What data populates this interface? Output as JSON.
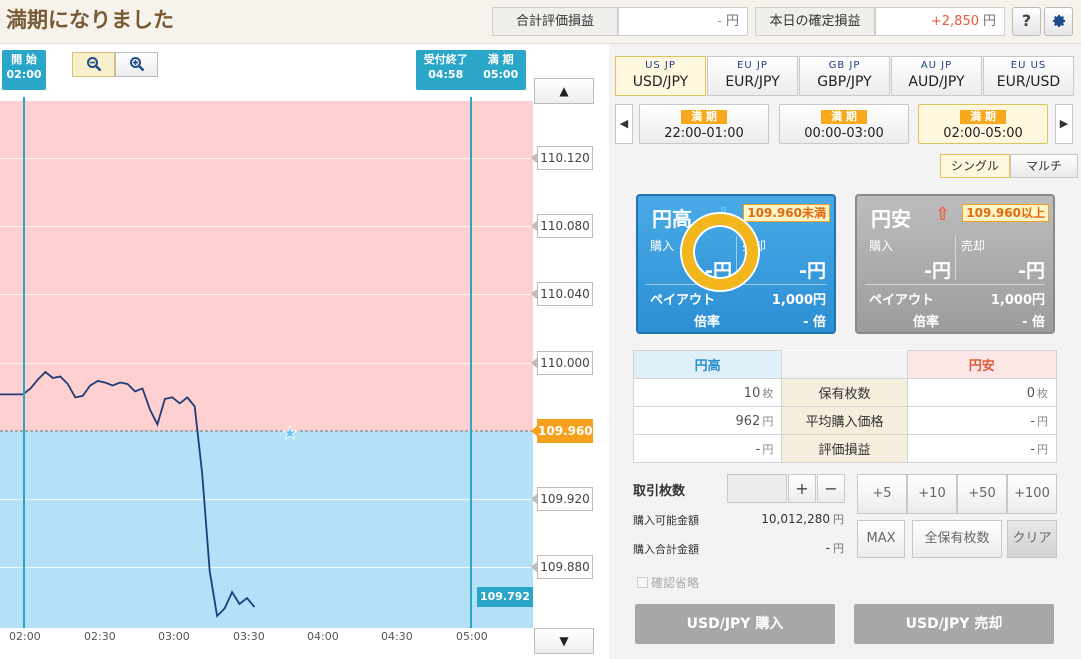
{
  "header": {
    "title": "満期になりました",
    "eval_label": "合計評価損益",
    "eval_value": "-",
    "eval_unit": "円",
    "fixed_label": "本日の確定損益",
    "fixed_value": "+2,850",
    "fixed_unit": "円",
    "help_icon": "question-icon",
    "settings_icon": "gear-icon"
  },
  "chart": {
    "start_flag": {
      "label": "開 始",
      "time": "02:00"
    },
    "close_flag": {
      "label1": "受付終了",
      "time1": "04:58",
      "label2": "満 期",
      "time2": "05:00"
    },
    "zoom_out_icon": "zoom-out-icon",
    "zoom_in_icon": "zoom-in-icon",
    "scroll_up": "▲",
    "scroll_down": "▼",
    "y_labels": [
      "110.120",
      "110.080",
      "110.040",
      "110.000",
      "109.960",
      "109.920",
      "109.880"
    ],
    "current_strike": "109.960",
    "last_price": "109.792",
    "x_labels": [
      "02:00",
      "02:30",
      "03:00",
      "03:30",
      "04:00",
      "04:30",
      "05:00"
    ],
    "up_zone_color": "#ffd0d0",
    "down_zone_color": "#b4e0f8"
  },
  "chart_data": {
    "type": "line",
    "xlabel": "",
    "ylabel": "",
    "x": [
      "02:00",
      "02:03",
      "02:06",
      "02:09",
      "02:12",
      "02:15",
      "02:18",
      "02:21",
      "02:24",
      "02:27",
      "02:30",
      "02:33",
      "02:36",
      "02:39",
      "02:42",
      "02:45",
      "02:48",
      "02:51",
      "02:54",
      "02:57",
      "03:00",
      "03:03",
      "03:06",
      "03:09",
      "03:12",
      "03:15",
      "03:18",
      "03:21",
      "03:24",
      "03:27",
      "03:30",
      "03:33"
    ],
    "series": [
      {
        "values": [
          109.948,
          109.952,
          109.958,
          109.963,
          109.959,
          109.96,
          109.955,
          109.946,
          109.947,
          109.954,
          109.957,
          109.956,
          109.954,
          109.956,
          109.955,
          109.95,
          109.952,
          109.938,
          109.928,
          109.945,
          109.946,
          109.942,
          109.946,
          109.94,
          109.895,
          109.83,
          109.8,
          109.805,
          109.816,
          109.808,
          109.812,
          109.806
        ]
      }
    ],
    "xlim": [
      "02:00",
      "05:00"
    ],
    "ylim": [
      109.792,
      110.144
    ],
    "strike": 109.96,
    "grid": true
  },
  "pairs": [
    {
      "name": "USD/JPY",
      "flags": "US JP",
      "selected": true
    },
    {
      "name": "EUR/JPY",
      "flags": "EU JP",
      "selected": false
    },
    {
      "name": "GBP/JPY",
      "flags": "GB JP",
      "selected": false
    },
    {
      "name": "AUD/JPY",
      "flags": "AU JP",
      "selected": false
    },
    {
      "name": "EUR/USD",
      "flags": "EU US",
      "selected": false
    }
  ],
  "periods": [
    {
      "tag": "満 期",
      "time": "22:00-01:00",
      "selected": false
    },
    {
      "tag": "満 期",
      "time": "00:00-03:00",
      "selected": false
    },
    {
      "tag": "満 期",
      "time": "02:00-05:00",
      "selected": true
    }
  ],
  "mode": {
    "single": "シングル",
    "multi": "マルチ"
  },
  "card_up": {
    "title": "円高",
    "arrow": "⇩",
    "badge": "109.960未満",
    "buy_label": "購入",
    "sell_label": "売却",
    "buy_value": "-円",
    "sell_value": "-円",
    "payout_label": "ペイアウト",
    "payout_value": "1,000円",
    "rate_label": "倍率",
    "rate_value": "- 倍"
  },
  "card_down": {
    "title": "円安",
    "arrow": "⇧",
    "badge": "109.960以上",
    "buy_label": "購入",
    "sell_label": "売却",
    "buy_value": "-円",
    "sell_value": "-円",
    "payout_label": "ペイアウト",
    "payout_value": "1,000円",
    "rate_label": "倍率",
    "rate_value": "- 倍"
  },
  "positions": {
    "up_header": "円高",
    "down_header": "円安",
    "rows": [
      {
        "label": "保有枚数",
        "up": "10",
        "up_unit": "枚",
        "down": "0",
        "down_unit": "枚"
      },
      {
        "label": "平均購入価格",
        "up": "962",
        "up_unit": "円",
        "down": "-",
        "down_unit": "円"
      },
      {
        "label": "評価損益",
        "up": "-",
        "up_unit": "円",
        "down": "-",
        "down_unit": "円"
      }
    ]
  },
  "order": {
    "qty_label": "取引枚数",
    "plus": "+",
    "minus": "−",
    "increments": [
      "+5",
      "+10",
      "+50",
      "+100"
    ],
    "avail_label": "購入可能金額",
    "avail_value": "10,012,280",
    "avail_unit": "円",
    "total_label": "購入合計金額",
    "total_value": "-",
    "total_unit": "円",
    "max_label": "MAX",
    "all_label": "全保有枚数",
    "clear_label": "クリア",
    "confirm_label": "確認省略",
    "buy_label": "USD/JPY 購入",
    "sell_label": "USD/JPY 売却"
  }
}
